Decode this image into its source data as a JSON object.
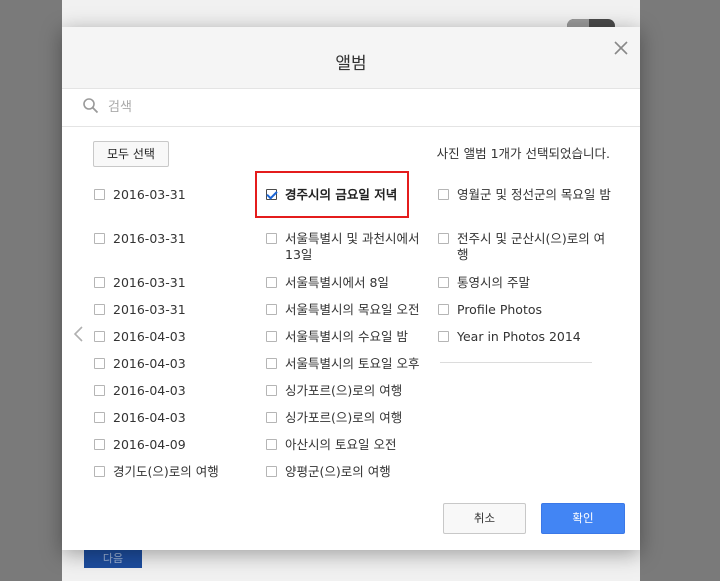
{
  "background": {
    "next_button_label": "다음"
  },
  "dialog": {
    "title": "앨범",
    "search_placeholder": "검색",
    "select_all_label": "모두 선택",
    "status": "사진 앨범 1개가 선택되었습니다.",
    "cancel_label": "취소",
    "ok_label": "확인",
    "accent_color": "#4285f4",
    "highlight_color": "#e41c1c"
  },
  "albums": {
    "col1": [
      {
        "label": "2016-03-31",
        "checked": false
      },
      {
        "label": "2016-03-31",
        "checked": false
      },
      {
        "label": "2016-03-31",
        "checked": false
      },
      {
        "label": "2016-03-31",
        "checked": false
      },
      {
        "label": "2016-04-03",
        "checked": false
      },
      {
        "label": "2016-04-03",
        "checked": false
      },
      {
        "label": "2016-04-03",
        "checked": false
      },
      {
        "label": "2016-04-03",
        "checked": false
      },
      {
        "label": "2016-04-09",
        "checked": false
      },
      {
        "label": "경기도(으)로의 여행",
        "checked": false
      }
    ],
    "col2": [
      {
        "label": "경주시의 금요일 저녁",
        "checked": true
      },
      {
        "label": "서울특별시 및 과천시에서 13일",
        "checked": false
      },
      {
        "label": "서울특별시에서 8일",
        "checked": false
      },
      {
        "label": "서울특별시의 목요일 오전",
        "checked": false
      },
      {
        "label": "서울특별시의 수요일 밤",
        "checked": false
      },
      {
        "label": "서울특별시의 토요일 오후",
        "checked": false
      },
      {
        "label": "싱가포르(으)로의 여행",
        "checked": false
      },
      {
        "label": "싱가포르(으)로의 여행",
        "checked": false
      },
      {
        "label": "아산시의 토요일 오전",
        "checked": false
      },
      {
        "label": "양평군(으)로의 여행",
        "checked": false
      }
    ],
    "col3": [
      {
        "label": "영월군 및 정선군의 목요일 밤",
        "checked": false
      },
      {
        "label": "전주시 및 군산시(으)로의 여행",
        "checked": false
      },
      {
        "label": "통영시의 주말",
        "checked": false
      },
      {
        "label": "Profile Photos",
        "checked": false
      },
      {
        "label": "Year in Photos 2014",
        "checked": false
      }
    ]
  }
}
